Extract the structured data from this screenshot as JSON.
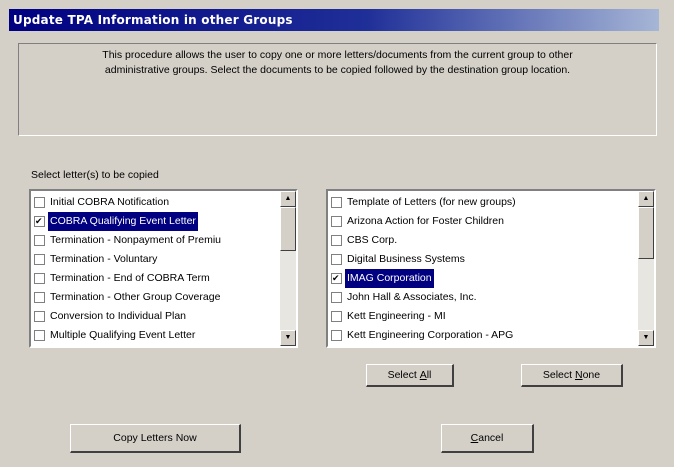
{
  "window": {
    "title": "Update TPA Information in other Groups"
  },
  "description": {
    "line1": "This procedure allows the user to copy one or more letters/documents from the current group to other",
    "line2": "administrative groups.  Select the documents to be copied followed by the destination group location."
  },
  "letters": {
    "label": "Select letter(s) to be copied",
    "items": [
      {
        "label": "Initial COBRA Notification",
        "checked": false,
        "selected": false
      },
      {
        "label": "COBRA Qualifying Event Letter",
        "checked": true,
        "selected": true
      },
      {
        "label": "Termination - Nonpayment of Premiu",
        "checked": false,
        "selected": false
      },
      {
        "label": "Termination - Voluntary",
        "checked": false,
        "selected": false
      },
      {
        "label": "Termination - End of COBRA Term",
        "checked": false,
        "selected": false
      },
      {
        "label": "Termination - Other Group Coverage",
        "checked": false,
        "selected": false
      },
      {
        "label": "Conversion to Individual Plan",
        "checked": false,
        "selected": false
      },
      {
        "label": "Multiple Qualifying Event Letter",
        "checked": false,
        "selected": false
      }
    ]
  },
  "groups": {
    "items": [
      {
        "label": "Template of Letters (for new groups)",
        "checked": false,
        "selected": false
      },
      {
        "label": "Arizona Action for Foster Children",
        "checked": false,
        "selected": false
      },
      {
        "label": "CBS Corp.",
        "checked": false,
        "selected": false
      },
      {
        "label": "Digital Business Systems",
        "checked": false,
        "selected": false
      },
      {
        "label": "IMAG Corporation",
        "checked": true,
        "selected": true
      },
      {
        "label": "John Hall & Associates, Inc.",
        "checked": false,
        "selected": false
      },
      {
        "label": "Kett Engineering - MI",
        "checked": false,
        "selected": false
      },
      {
        "label": "Kett Engineering Corporation - APG",
        "checked": false,
        "selected": false
      }
    ]
  },
  "buttons": {
    "select_all_pre": "Select ",
    "select_all_accel": "A",
    "select_all_post": "ll",
    "select_none_pre": "Select ",
    "select_none_accel": "N",
    "select_none_post": "one",
    "copy": "Copy Letters Now",
    "cancel_accel": "C",
    "cancel_post": "ancel"
  },
  "icons": {
    "scroll_up": "triangle-up",
    "scroll_down": "triangle-down",
    "checkmark": "check-icon"
  }
}
